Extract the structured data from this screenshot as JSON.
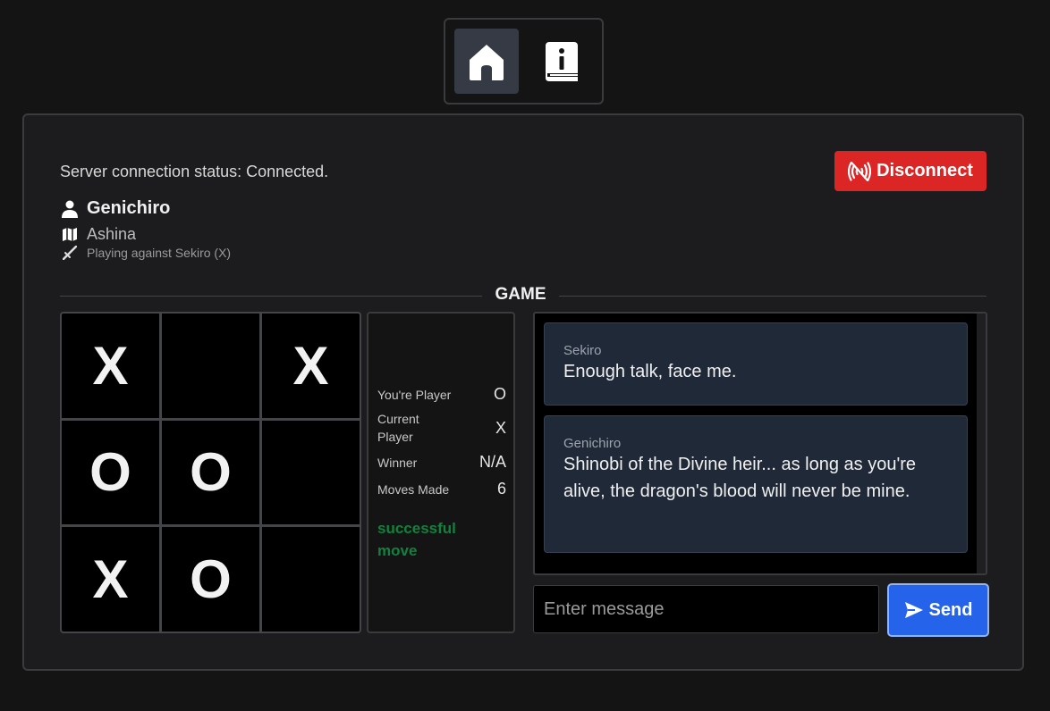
{
  "nav": {
    "home_icon": "home-icon",
    "info_icon": "book-info-icon"
  },
  "connection": {
    "status": "Server connection status: Connected.",
    "disconnect_label": "Disconnect"
  },
  "player": {
    "name": "Genichiro",
    "clan": "Ashina",
    "opponent": "Playing against Sekiro (X)"
  },
  "section_title": "GAME",
  "board": [
    "X",
    "",
    "X",
    "O",
    "O",
    "",
    "X",
    "O",
    ""
  ],
  "stats": {
    "you_label": "You're Player",
    "you_value": "O",
    "current_label": "Current Player",
    "current_value": "X",
    "winner_label": "Winner",
    "winner_value": "N/A",
    "moves_label": "Moves Made",
    "moves_value": "6",
    "message": "successful move"
  },
  "chat": {
    "messages": [
      {
        "sender": "Sekiro",
        "text": "Enough talk, face me."
      },
      {
        "sender": "Genichiro",
        "text": "Shinobi of the Divine heir... as long as you're alive, the dragon's blood will never be mine."
      }
    ],
    "placeholder": "Enter message",
    "send_label": "Send"
  },
  "colors": {
    "disconnect": "#dc2626",
    "send": "#2563eb",
    "success": "#15803d",
    "bubble": "#1f2937"
  }
}
